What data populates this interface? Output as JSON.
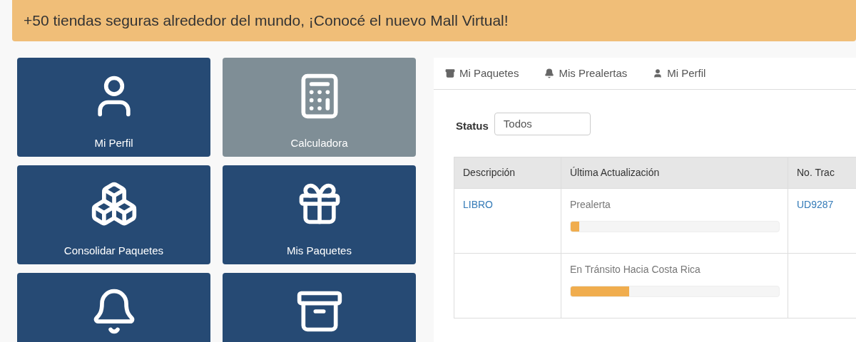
{
  "banner": {
    "text": "+50 tiendas seguras alrededor del mundo, ¡Conocé el nuevo Mall Virtual!"
  },
  "tiles": [
    {
      "label": "Mi Perfil",
      "selected": false
    },
    {
      "label": "Calculadora",
      "selected": true
    },
    {
      "label": "Consolidar Paquetes",
      "selected": false
    },
    {
      "label": "Mis Paquetes",
      "selected": false
    },
    {
      "selected": false
    },
    {
      "selected": false
    }
  ],
  "tabs": [
    {
      "label": "Mi Paquetes"
    },
    {
      "label": "Mis Prealertas"
    },
    {
      "label": "Mi Perfil"
    }
  ],
  "filter": {
    "label": "Status",
    "value": "Todos"
  },
  "table": {
    "columns": [
      "Descripción",
      "Última Actualización",
      "No. Trac"
    ],
    "rows": [
      {
        "description": "LIBRO",
        "status": "Prealerta",
        "level": 0.04,
        "tracking": "UD9287"
      },
      {
        "status": "En Tránsito Hacia Costa Rica",
        "level": 0.28
      }
    ]
  }
}
